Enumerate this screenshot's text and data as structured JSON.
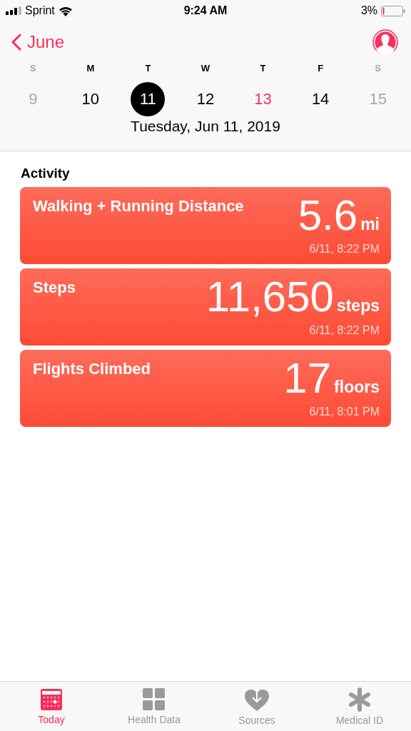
{
  "status_bar": {
    "carrier": "Sprint",
    "time": "9:24 AM",
    "battery": "3%"
  },
  "nav": {
    "back": "June"
  },
  "week": [
    {
      "letter": "S",
      "number": "9",
      "kind": "weekend",
      "selected": false
    },
    {
      "letter": "M",
      "number": "10",
      "kind": "weekday",
      "selected": false
    },
    {
      "letter": "T",
      "number": "11",
      "kind": "weekday",
      "selected": true
    },
    {
      "letter": "W",
      "number": "12",
      "kind": "weekday",
      "selected": false
    },
    {
      "letter": "T",
      "number": "13",
      "kind": "today",
      "selected": false
    },
    {
      "letter": "F",
      "number": "14",
      "kind": "weekday",
      "selected": false
    },
    {
      "letter": "S",
      "number": "15",
      "kind": "weekend",
      "selected": false
    }
  ],
  "date": "Tuesday, Jun 11, 2019",
  "section": "Activity",
  "cards": [
    {
      "title": "Walking + Running Distance",
      "value": "5.6",
      "unit": "mi",
      "time": "6/11, 8:22 PM"
    },
    {
      "title": "Steps",
      "value": "11,650",
      "unit": "steps",
      "time": "6/11, 8:22 PM"
    },
    {
      "title": "Flights Climbed",
      "value": "17",
      "unit": "floors",
      "time": "6/11, 8:01 PM"
    }
  ],
  "tabs": [
    {
      "label": "Today",
      "kind": "calendar",
      "selected": true
    },
    {
      "label": "Health Data",
      "kind": "grid",
      "selected": false
    },
    {
      "label": "Sources",
      "kind": "heart",
      "selected": false
    },
    {
      "label": "Medical ID",
      "kind": "asterisk",
      "selected": false
    }
  ]
}
